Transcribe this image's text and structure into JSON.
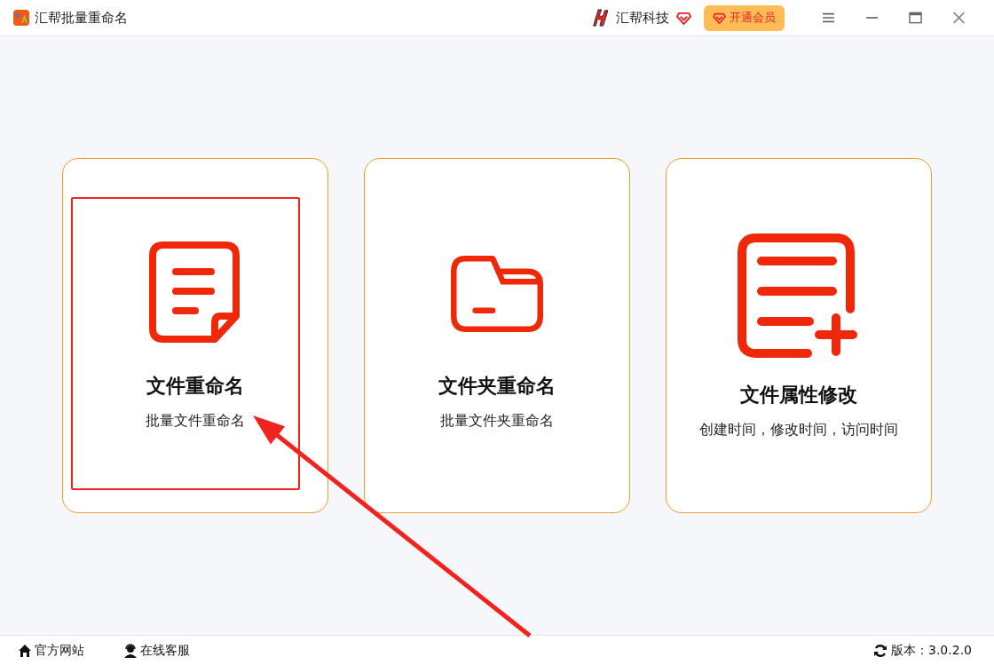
{
  "window": {
    "title": "汇帮批量重命名"
  },
  "header": {
    "brand": "汇帮科技",
    "vip_button": "开通会员"
  },
  "cards": [
    {
      "kind": "file",
      "title": "文件重命名",
      "subtitle": "批量文件重命名",
      "highlighted": true
    },
    {
      "kind": "folder",
      "title": "文件夹重命名",
      "subtitle": "批量文件夹重命名",
      "highlighted": false
    },
    {
      "kind": "file-plus",
      "title": "文件属性修改",
      "subtitle": "创建时间，修改时间，访问时间",
      "highlighted": false
    }
  ],
  "status_bar": {
    "links": [
      {
        "kind": "home",
        "label": "官方网站"
      },
      {
        "kind": "support",
        "label": "在线客服"
      }
    ],
    "version": "版本：3.0.2.0"
  }
}
